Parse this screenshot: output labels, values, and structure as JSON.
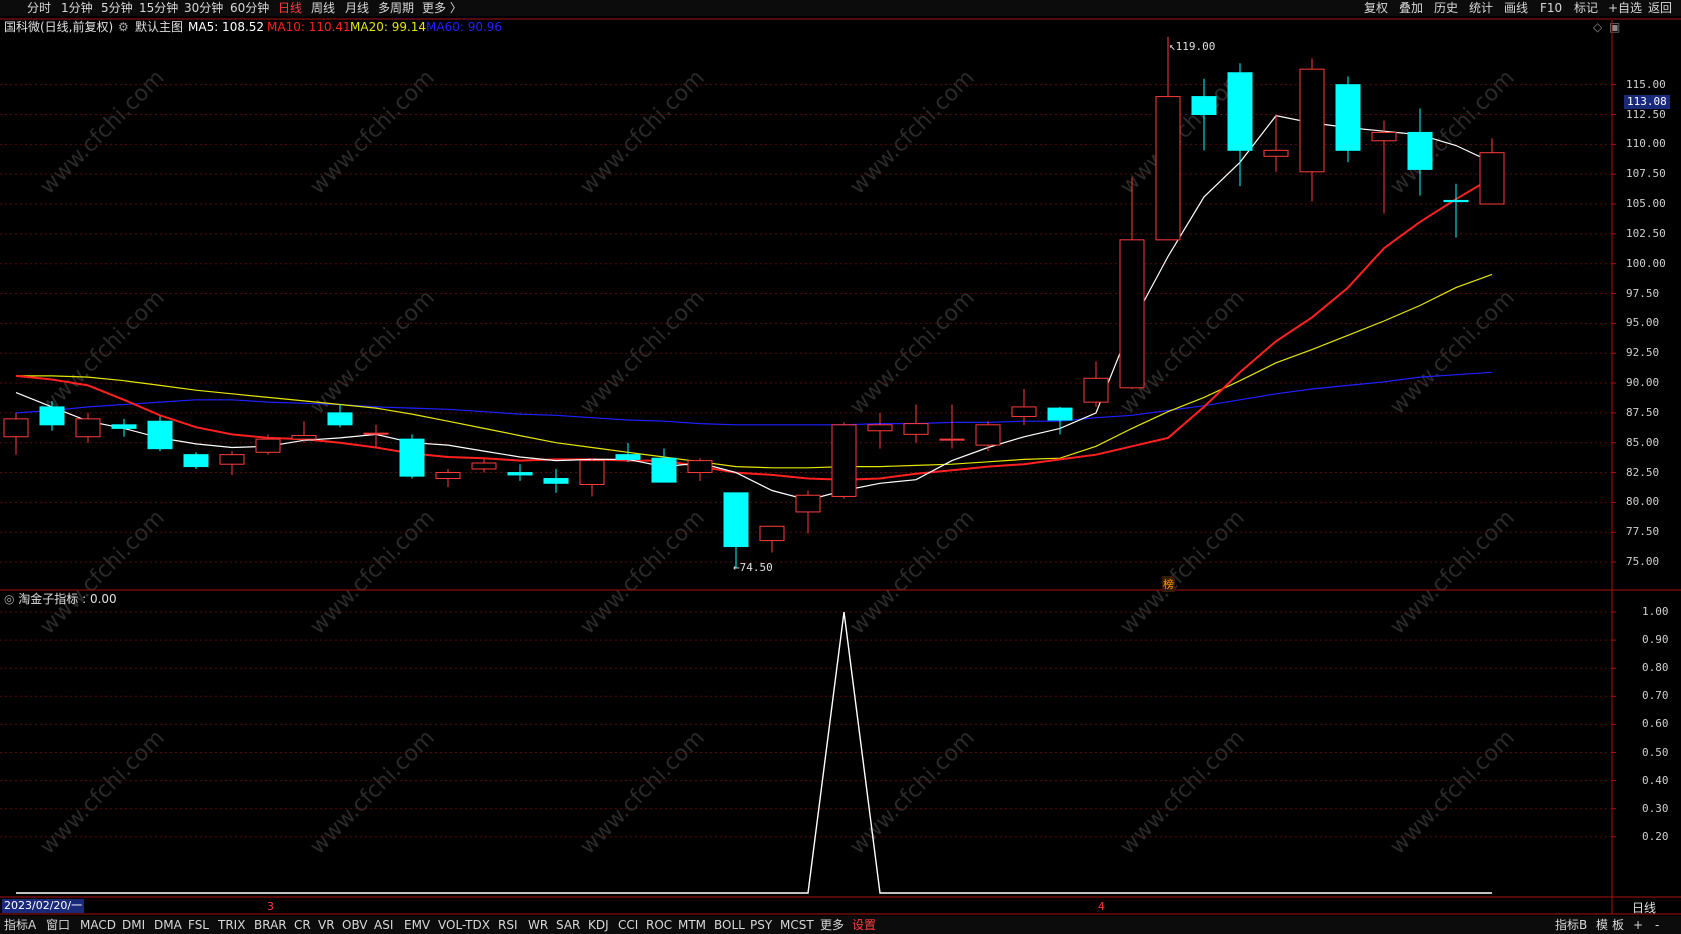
{
  "top_toolbar": {
    "left_tabs": [
      "分时",
      "1分钟",
      "5分钟",
      "15分钟",
      "30分钟",
      "60分钟",
      "日线",
      "周线",
      "月线",
      "多周期",
      "更多 〉"
    ],
    "active_tab": "日线",
    "right_tools": [
      "复权",
      "叠加",
      "历史",
      "统计",
      "画线",
      "F10",
      "标记",
      "+自选",
      "返回"
    ]
  },
  "info": {
    "stock": "国科微(日线,前复权)",
    "main_chart": "默认主图",
    "ma5": "MA5: 108.52",
    "ma10": "MA10: 110.41",
    "ma20": "MA20: 99.14",
    "ma60": "MA60: 90.96",
    "colors": {
      "ma5": "#ffffff",
      "ma10": "#ff2020",
      "ma20": "#e6e600",
      "ma60": "#2020ff"
    }
  },
  "price_axis": [
    "115.00",
    "112.50",
    "110.00",
    "107.50",
    "105.00",
    "102.50",
    "100.00",
    "97.50",
    "95.00",
    "92.50",
    "90.00",
    "87.50",
    "85.00",
    "82.50",
    "80.00",
    "77.50",
    "75.00"
  ],
  "current_price": "113.08",
  "high_label": "119.00",
  "low_label": "74.50",
  "bang_label": "榜",
  "indicator": {
    "title": "淘金子指标 : 0.00",
    "axis": [
      "1.00",
      "0.90",
      "0.80",
      "0.70",
      "0.60",
      "0.50",
      "0.40",
      "0.30",
      "0.20"
    ]
  },
  "x_axis": {
    "start_date": "2023/02/20/一",
    "month_3": "3",
    "month_4": "4",
    "period": "日线"
  },
  "watermark": "www.cfchi.com",
  "bottom_toolbar": {
    "items": [
      "指标A",
      "窗口",
      "MACD",
      "DMI",
      "DMA",
      "FSL",
      "TRIX",
      "BRAR",
      "CR",
      "VR",
      "OBV",
      "ASI",
      "EMV",
      "VOL-TDX",
      "RSI",
      "WR",
      "SAR",
      "KDJ",
      "CCI",
      "ROC",
      "MTM",
      "BOLL",
      "PSY",
      "MCST",
      "更多",
      "设置"
    ],
    "active": "设置",
    "right_items": [
      "指标B",
      "模",
      "板",
      "+",
      "-"
    ]
  },
  "chart_data": {
    "type": "candlestick",
    "up_color": "#ff3c3c",
    "down_color": "#00ffff",
    "candles": [
      {
        "o": 85.5,
        "h": 87.5,
        "l": 84.0,
        "c": 87.0
      },
      {
        "o": 88.0,
        "h": 88.5,
        "l": 86.0,
        "c": 86.5
      },
      {
        "o": 85.5,
        "h": 87.5,
        "l": 85.0,
        "c": 87.0
      },
      {
        "o": 86.5,
        "h": 87.0,
        "l": 85.5,
        "c": 86.2
      },
      {
        "o": 86.8,
        "h": 87.2,
        "l": 84.3,
        "c": 84.5
      },
      {
        "o": 84.0,
        "h": 84.2,
        "l": 82.8,
        "c": 83.0
      },
      {
        "o": 83.2,
        "h": 84.3,
        "l": 82.3,
        "c": 84.0
      },
      {
        "o": 84.2,
        "h": 85.7,
        "l": 84.0,
        "c": 85.3
      },
      {
        "o": 85.3,
        "h": 86.8,
        "l": 85.0,
        "c": 85.6
      },
      {
        "o": 87.5,
        "h": 88.2,
        "l": 86.3,
        "c": 86.5
      },
      {
        "o": 85.8,
        "h": 86.5,
        "l": 84.6,
        "c": 85.8
      },
      {
        "o": 85.3,
        "h": 85.7,
        "l": 82.0,
        "c": 82.2
      },
      {
        "o": 82.0,
        "h": 82.8,
        "l": 81.3,
        "c": 82.5
      },
      {
        "o": 82.8,
        "h": 83.7,
        "l": 82.5,
        "c": 83.3
      },
      {
        "o": 82.5,
        "h": 83.2,
        "l": 81.8,
        "c": 82.3
      },
      {
        "o": 82.0,
        "h": 82.8,
        "l": 80.8,
        "c": 81.6
      },
      {
        "o": 81.5,
        "h": 83.7,
        "l": 80.5,
        "c": 83.5
      },
      {
        "o": 84.0,
        "h": 85.0,
        "l": 83.4,
        "c": 83.6
      },
      {
        "o": 83.7,
        "h": 84.5,
        "l": 81.8,
        "c": 81.7
      },
      {
        "o": 82.5,
        "h": 83.7,
        "l": 81.8,
        "c": 83.5
      },
      {
        "o": 80.8,
        "h": 80.8,
        "l": 74.5,
        "c": 76.3
      },
      {
        "o": 76.8,
        "h": 78.0,
        "l": 75.8,
        "c": 78.0
      },
      {
        "o": 79.2,
        "h": 81.0,
        "l": 77.4,
        "c": 80.6
      },
      {
        "o": 80.5,
        "h": 86.7,
        "l": 80.3,
        "c": 86.5
      },
      {
        "o": 86.0,
        "h": 87.5,
        "l": 84.5,
        "c": 86.5
      },
      {
        "o": 85.7,
        "h": 88.2,
        "l": 85.0,
        "c": 86.6
      },
      {
        "o": 85.3,
        "h": 88.2,
        "l": 84.5,
        "c": 85.3
      },
      {
        "o": 84.8,
        "h": 86.8,
        "l": 84.3,
        "c": 86.5
      },
      {
        "o": 87.2,
        "h": 89.5,
        "l": 86.5,
        "c": 88.0
      },
      {
        "o": 87.9,
        "h": 88.0,
        "l": 85.7,
        "c": 86.9
      },
      {
        "o": 88.4,
        "h": 91.8,
        "l": 88.0,
        "c": 90.4
      },
      {
        "o": 89.6,
        "h": 107.2,
        "l": 89.5,
        "c": 102.0
      },
      {
        "o": 102.0,
        "h": 119.0,
        "l": 102.0,
        "c": 114.0
      },
      {
        "o": 114.0,
        "h": 115.5,
        "l": 109.5,
        "c": 112.5
      },
      {
        "o": 116.0,
        "h": 116.8,
        "l": 106.5,
        "c": 109.5
      },
      {
        "o": 109.0,
        "h": 112.5,
        "l": 107.7,
        "c": 109.5
      },
      {
        "o": 107.7,
        "h": 117.2,
        "l": 105.2,
        "c": 116.3
      },
      {
        "o": 115.0,
        "h": 115.7,
        "l": 108.5,
        "c": 109.5
      },
      {
        "o": 110.3,
        "h": 112.0,
        "l": 104.2,
        "c": 111.0
      },
      {
        "o": 111.0,
        "h": 113.0,
        "l": 105.7,
        "c": 107.9
      },
      {
        "o": 105.3,
        "h": 106.7,
        "l": 102.2,
        "c": 105.2
      },
      {
        "o": 105.0,
        "h": 110.5,
        "l": 105.0,
        "c": 109.3
      }
    ],
    "ma5": [
      89.2,
      88.0,
      86.8,
      86.2,
      85.4,
      84.9,
      84.6,
      84.7,
      85.2,
      85.4,
      85.7,
      85.0,
      84.8,
      84.3,
      83.8,
      83.5,
      83.6,
      83.6,
      83.0,
      83.3,
      82.5,
      81.0,
      80.2,
      81.0,
      81.6,
      81.9,
      83.5,
      84.6,
      85.5,
      86.2,
      87.5,
      95.0,
      100.6,
      105.6,
      108.5,
      112.4,
      111.8,
      111.4,
      111.1,
      110.8,
      109.9,
      108.5
    ],
    "ma10": [
      90.6,
      90.3,
      89.8,
      88.6,
      87.3,
      86.3,
      85.7,
      85.4,
      85.3,
      85.0,
      84.6,
      84.1,
      83.8,
      83.7,
      83.5,
      83.6,
      83.6,
      83.5,
      83.5,
      83.0,
      82.5,
      82.3,
      82.0,
      81.9,
      82.0,
      82.4,
      82.7,
      83.0,
      83.2,
      83.6,
      84.0,
      84.7,
      85.4,
      88.0,
      90.9,
      93.5,
      95.5,
      98.0,
      101.3,
      103.5,
      105.4,
      107.2
    ],
    "ma20": [
      90.6,
      90.6,
      90.5,
      90.2,
      89.8,
      89.4,
      89.1,
      88.8,
      88.5,
      88.2,
      87.9,
      87.4,
      86.8,
      86.2,
      85.6,
      85.0,
      84.6,
      84.2,
      83.8,
      83.4,
      83.0,
      82.9,
      82.9,
      83.0,
      83.0,
      83.1,
      83.2,
      83.4,
      83.6,
      83.7,
      84.7,
      86.2,
      87.6,
      88.8,
      90.2,
      91.7,
      92.8,
      94.0,
      95.2,
      96.5,
      98.0,
      99.1
    ],
    "ma60": [
      87.5,
      87.7,
      88.0,
      88.2,
      88.4,
      88.6,
      88.6,
      88.4,
      88.3,
      88.2,
      88.0,
      87.9,
      87.8,
      87.6,
      87.4,
      87.3,
      87.1,
      86.9,
      86.8,
      86.6,
      86.5,
      86.5,
      86.5,
      86.5,
      86.6,
      86.6,
      86.7,
      86.7,
      86.8,
      86.8,
      87.1,
      87.3,
      87.7,
      88.1,
      88.6,
      89.1,
      89.5,
      89.8,
      90.1,
      90.5,
      90.7,
      90.9
    ],
    "indicator_values": [
      0,
      0,
      0,
      0,
      0,
      0,
      0,
      0,
      0,
      0,
      0,
      0,
      0,
      0,
      0,
      0,
      0,
      0,
      0,
      0,
      0,
      0,
      0,
      1,
      0,
      0,
      0,
      0,
      0,
      0,
      0,
      0,
      0,
      0,
      0,
      0,
      0,
      0,
      0,
      0,
      0,
      0
    ],
    "y_range": [
      73.5,
      120.5
    ],
    "indicator_range": [
      0,
      1
    ]
  }
}
